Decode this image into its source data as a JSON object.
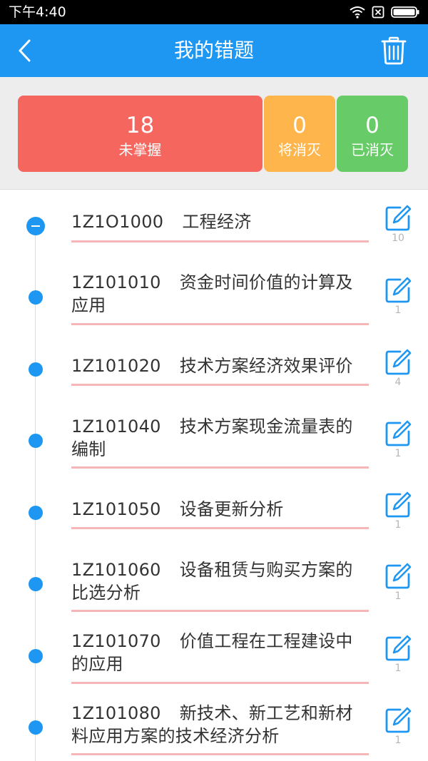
{
  "status_bar": {
    "time": "下午4:40"
  },
  "header": {
    "title": "我的错题"
  },
  "stats": {
    "unmastered": {
      "count": "18",
      "label": "未掌握"
    },
    "eliminating": {
      "count": "0",
      "label": "将消灭"
    },
    "eliminated": {
      "count": "0",
      "label": "已消灭"
    }
  },
  "colors": {
    "primary": "#1e97f3",
    "unmastered": "#f4665e",
    "eliminating": "#fdb54c",
    "eliminated": "#67cc67",
    "divider": "#f4b6b6"
  },
  "chapters": [
    {
      "code": "1Z1O1000",
      "title": "工程经济",
      "line1": "",
      "line2": "",
      "count": "10"
    },
    {
      "code": "1Z101010",
      "title": "",
      "line1": "资金时间价值的计算及",
      "line2": "应用",
      "count": "1"
    },
    {
      "code": "1Z101020",
      "title": "技术方案经济效果评价",
      "line1": "",
      "line2": "",
      "count": "4"
    },
    {
      "code": "1Z101040",
      "title": "",
      "line1": "技术方案现金流量表的",
      "line2": "编制",
      "count": "1"
    },
    {
      "code": "1Z101050",
      "title": "设备更新分析",
      "line1": "",
      "line2": "",
      "count": "1"
    },
    {
      "code": "1Z101060",
      "title": "",
      "line1": "设备租赁与购买方案的",
      "line2": "比选分析",
      "count": "1"
    },
    {
      "code": "1Z101070",
      "title": "",
      "line1": "价值工程在工程建设中",
      "line2": "的应用",
      "count": "1"
    },
    {
      "code": "1Z101080",
      "title": "",
      "line1": "新技术、新工艺和新材",
      "line2": "料应用方案的技术经济分析",
      "count": "1"
    }
  ]
}
